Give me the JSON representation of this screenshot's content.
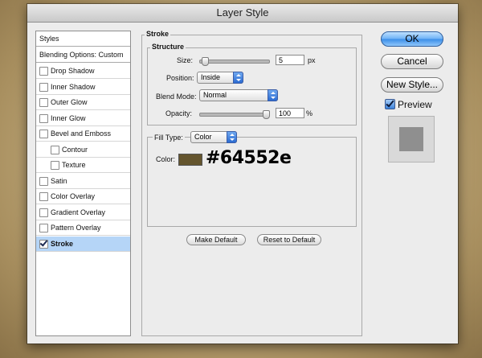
{
  "window": {
    "title": "Layer Style"
  },
  "styles_list": {
    "header": "Styles",
    "blending": "Blending Options: Custom",
    "items": [
      {
        "label": "Drop Shadow",
        "checked": false,
        "indent": false
      },
      {
        "label": "Inner Shadow",
        "checked": false,
        "indent": false
      },
      {
        "label": "Outer Glow",
        "checked": false,
        "indent": false
      },
      {
        "label": "Inner Glow",
        "checked": false,
        "indent": false
      },
      {
        "label": "Bevel and Emboss",
        "checked": false,
        "indent": false
      },
      {
        "label": "Contour",
        "checked": false,
        "indent": true
      },
      {
        "label": "Texture",
        "checked": false,
        "indent": true
      },
      {
        "label": "Satin",
        "checked": false,
        "indent": false
      },
      {
        "label": "Color Overlay",
        "checked": false,
        "indent": false
      },
      {
        "label": "Gradient Overlay",
        "checked": false,
        "indent": false
      },
      {
        "label": "Pattern Overlay",
        "checked": false,
        "indent": false
      },
      {
        "label": "Stroke",
        "checked": true,
        "indent": false,
        "selected": true
      }
    ]
  },
  "stroke": {
    "title": "Stroke",
    "structure_title": "Structure",
    "size_label": "Size:",
    "size_value": "5",
    "size_unit": "px",
    "size_slider_fraction": 0.03,
    "position_label": "Position:",
    "position_value": "Inside",
    "blend_label": "Blend Mode:",
    "blend_value": "Normal",
    "opacity_label": "Opacity:",
    "opacity_value": "100",
    "opacity_unit": "%",
    "opacity_slider_fraction": 1.0,
    "fill_type_label": "Fill Type:",
    "fill_type_value": "Color",
    "color_label": "Color:",
    "color_hex": "#64552e",
    "color_annotation": "#64552e",
    "make_default": "Make Default",
    "reset_default": "Reset to Default"
  },
  "buttons": {
    "ok": "OK",
    "cancel": "Cancel",
    "new_style": "New Style...",
    "preview": "Preview",
    "preview_checked": true
  },
  "colors": {
    "selected_row": "#b5d5f7",
    "preview_swatch": "#8f8f8f"
  }
}
